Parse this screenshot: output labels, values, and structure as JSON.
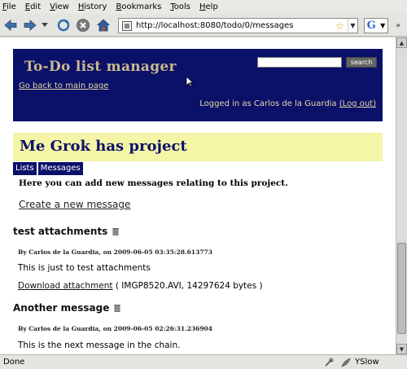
{
  "menubar": {
    "items": [
      {
        "accel": "F",
        "rest": "ile"
      },
      {
        "accel": "E",
        "rest": "dit"
      },
      {
        "accel": "V",
        "rest": "iew"
      },
      {
        "accel": "H",
        "rest": "istory"
      },
      {
        "accel": "B",
        "rest": "ookmarks"
      },
      {
        "accel": "T",
        "rest": "ools"
      },
      {
        "accel": "H",
        "rest": "elp"
      }
    ]
  },
  "toolbar": {
    "url": "http://localhost:8080/todo/0/messages"
  },
  "header": {
    "app_title": "To-Do list manager",
    "back_link": "Go back to main page",
    "search_button": "search",
    "logged_in_text": "Logged in as Carlos de la Guardia",
    "logout_link": "(Log out)"
  },
  "project": {
    "title": "Me Grok has project"
  },
  "tabs": [
    "Lists",
    "Messages"
  ],
  "intro_text": "Here you can add new messages relating to this project.",
  "create_link": "Create a new message",
  "messages": [
    {
      "title": "test attachments",
      "meta": "By Carlos de la Guardia, on 2009-06-05 03:35:28.613773",
      "body": "This is just to test attachments",
      "attachment_link": "Download attachment",
      "attachment_info": "( IMGP8520.AVI, 14297624 bytes )"
    },
    {
      "title": "Another message",
      "meta": "By Carlos de la Guardia, on 2009-06-05 02:26:31.236904",
      "body": "This is the next message in the chain."
    }
  ],
  "statusbar": {
    "status": "Done",
    "yslow": "YSlow"
  }
}
